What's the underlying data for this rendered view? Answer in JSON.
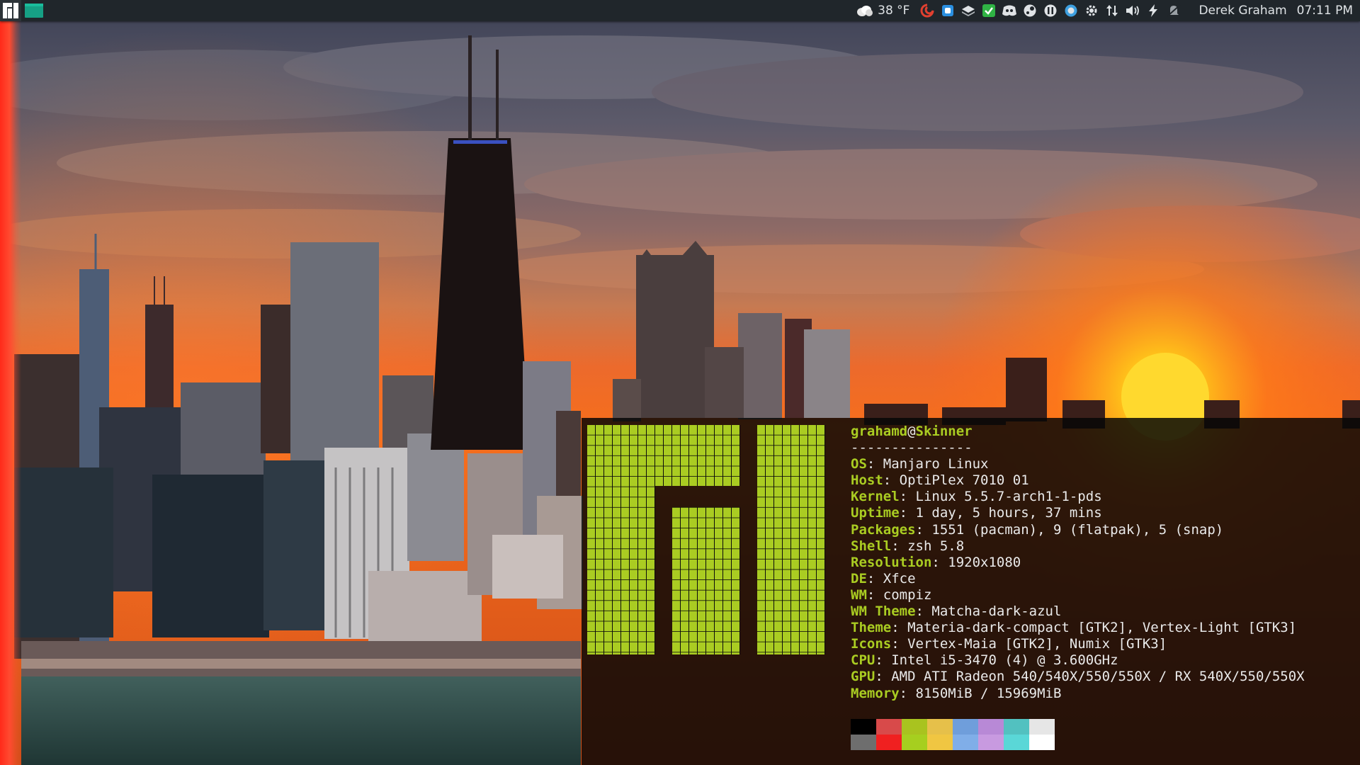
{
  "panel": {
    "weather": {
      "icon": "cloud-icon",
      "temperature": "38 °F"
    },
    "tray_icons": [
      {
        "name": "debian-swirl-icon",
        "color": "#e04030"
      },
      {
        "name": "signal-messenger-icon",
        "color": "#2a8fe0"
      },
      {
        "name": "layers-icon",
        "color": "#dfe3e6"
      },
      {
        "name": "checkmark-app-icon",
        "color": "#2fb344"
      },
      {
        "name": "discord-icon",
        "color": "#dfe3e6"
      },
      {
        "name": "steam-icon",
        "color": "#dfe3e6"
      },
      {
        "name": "synergy-icon",
        "color": "#dfe3e6"
      },
      {
        "name": "update-notifier-icon",
        "color": "#3ea0e0"
      },
      {
        "name": "settings-icon",
        "color": "#dfe3e6"
      },
      {
        "name": "network-icon",
        "color": "#dfe3e6"
      },
      {
        "name": "volume-icon",
        "color": "#dfe3e6"
      },
      {
        "name": "power-icon",
        "color": "#dfe3e6"
      },
      {
        "name": "notifications-icon",
        "color": "#9aa0a6"
      }
    ],
    "username": "Derek Graham",
    "clock": "07:11 PM"
  },
  "neofetch": {
    "user": "grahamd",
    "at": "@",
    "host": "Skinner",
    "separator": "---------------",
    "fields": [
      {
        "key": "OS",
        "value": "Manjaro Linux"
      },
      {
        "key": "Host",
        "value": "OptiPlex 7010 01"
      },
      {
        "key": "Kernel",
        "value": "Linux 5.5.7-arch1-1-pds"
      },
      {
        "key": "Uptime",
        "value": "1 day, 5 hours, 37 mins"
      },
      {
        "key": "Packages",
        "value": "1551 (pacman), 9 (flatpak), 5 (snap)"
      },
      {
        "key": "Shell",
        "value": "zsh 5.8"
      },
      {
        "key": "Resolution",
        "value": "1920x1080"
      },
      {
        "key": "DE",
        "value": "Xfce"
      },
      {
        "key": "WM",
        "value": "compiz"
      },
      {
        "key": "WM Theme",
        "value": "Matcha-dark-azul"
      },
      {
        "key": "Theme",
        "value": "Materia-dark-compact [GTK2], Vertex-Light [GTK3]"
      },
      {
        "key": "Icons",
        "value": "Vertex-Maia [GTK2], Numix [GTK3]"
      },
      {
        "key": "CPU",
        "value": "Intel i5-3470 (4) @ 3.600GHz"
      },
      {
        "key": "GPU",
        "value": "AMD ATI Radeon 540/540X/550/550X / RX 540X/550/550X"
      },
      {
        "key": "Memory",
        "value": "8150MiB / 15969MiB"
      }
    ],
    "palette_top": [
      "#000000",
      "#d84a4a",
      "#a9c31f",
      "#e6c04a",
      "#6f9edb",
      "#b889d6",
      "#52c1c0",
      "#e6e6e6"
    ],
    "palette_bottom": [
      "#6e6e6e",
      "#f02020",
      "#a6cf1f",
      "#f0c642",
      "#80aee8",
      "#c89ae0",
      "#5ad7d7",
      "#ffffff"
    ]
  },
  "colors": {
    "accent": "#aacc22",
    "panel_bg": "#20262b"
  }
}
